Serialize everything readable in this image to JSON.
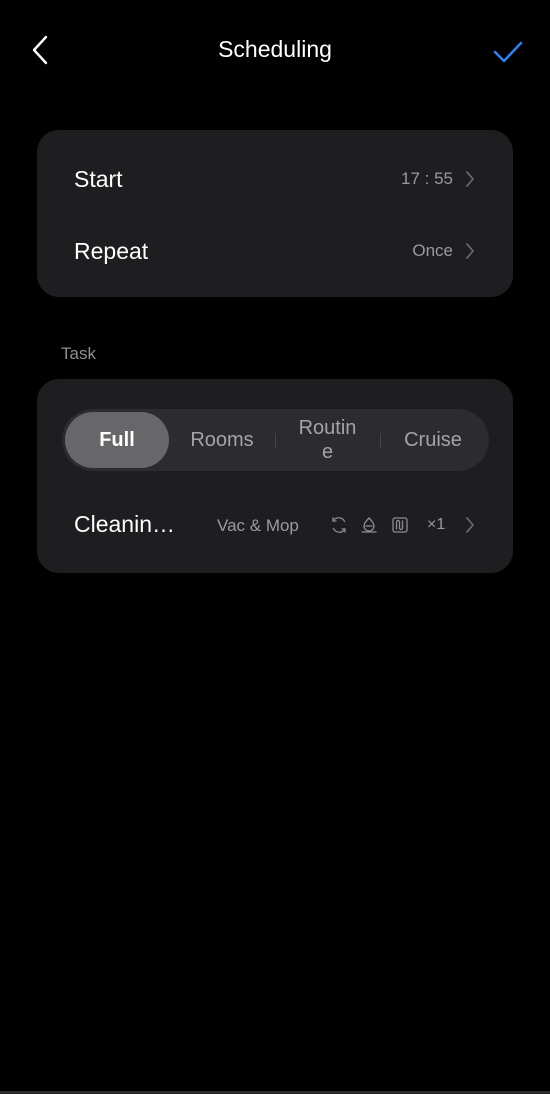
{
  "header": {
    "title": "Scheduling",
    "back_icon": "chevron-left-icon",
    "confirm_icon": "check-icon",
    "accent": "#2f7fef"
  },
  "schedule": {
    "start": {
      "label": "Start",
      "value": "17 : 55"
    },
    "repeat": {
      "label": "Repeat",
      "value": "Once"
    }
  },
  "task": {
    "section_label": "Task",
    "tabs": [
      {
        "label": "Full",
        "active": true
      },
      {
        "label": "Rooms",
        "active": false
      },
      {
        "label": "Routin\ne",
        "active": false
      },
      {
        "label": "Cruise",
        "active": false
      }
    ],
    "cleaning": {
      "label": "Cleaning mode",
      "mode": "Vac & Mop",
      "icons": [
        "suction-icon",
        "water-level-icon",
        "mop-route-icon"
      ],
      "times": "×1"
    }
  }
}
